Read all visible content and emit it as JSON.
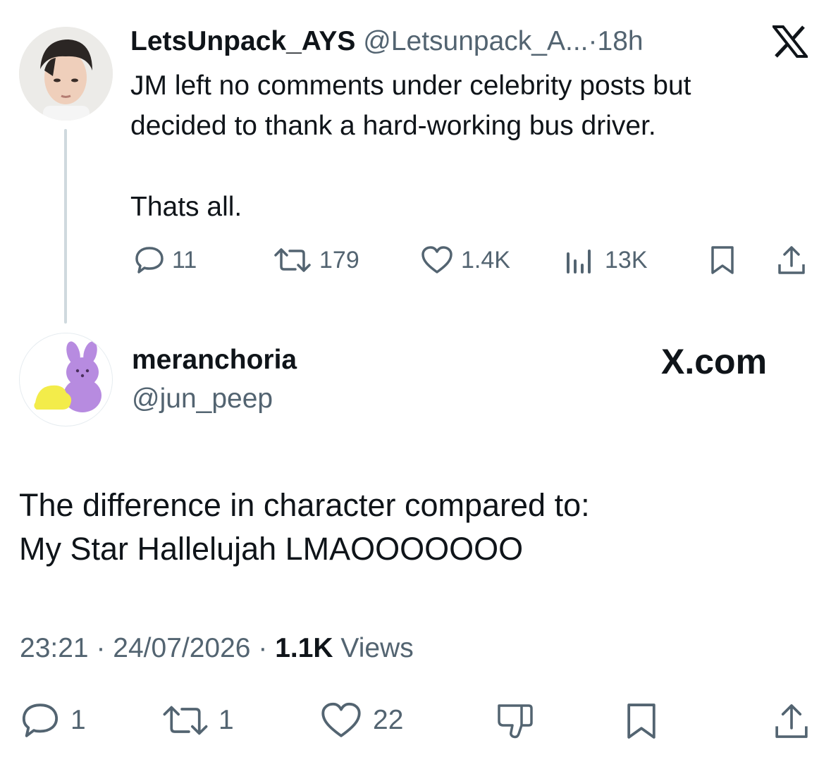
{
  "quoted_post": {
    "display_name": "LetsUnpack_AYS",
    "handle": "@Letsunpack_A...",
    "separator": "·",
    "time": "18h",
    "text_line1": "JM left no comments under celebrity posts but",
    "text_line2": "decided to thank a hard-working bus driver.",
    "text_line3": "Thats all.",
    "replies": "11",
    "reposts": "179",
    "likes": "1.4K",
    "views": "13K"
  },
  "main_post": {
    "display_name": "meranchoria",
    "handle": "@jun_peep",
    "brand": "X.com",
    "text_line1": "The difference in character compared to:",
    "text_line2": "My Star Hallelujah LMAOOOOOOO",
    "time": "23:21",
    "date": "24/07/2026",
    "sep1": "·",
    "sep2": "·",
    "views_count": "1.1K",
    "views_label": "Views",
    "replies": "1",
    "reposts": "1",
    "likes": "22"
  },
  "colors": {
    "text": "#0f1419",
    "muted": "#536471",
    "thread_line": "#cfd9de",
    "avatar2_bunny": "#b78be0",
    "avatar2_chick": "#f3ec4a"
  }
}
